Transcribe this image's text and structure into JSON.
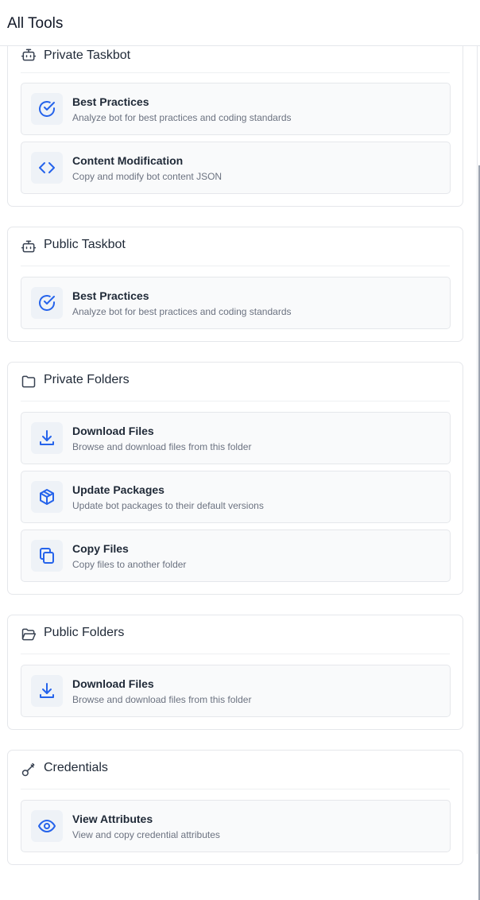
{
  "header": {
    "title": "All Tools"
  },
  "sections": [
    {
      "title": "Private Taskbot",
      "icon": "bot-icon",
      "tools": [
        {
          "title": "Best Practices",
          "description": "Analyze bot for best practices and coding standards",
          "icon": "check-circle-icon"
        },
        {
          "title": "Content Modification",
          "description": "Copy and modify bot content JSON",
          "icon": "code-icon"
        }
      ]
    },
    {
      "title": "Public Taskbot",
      "icon": "bot-icon",
      "tools": [
        {
          "title": "Best Practices",
          "description": "Analyze bot for best practices and coding standards",
          "icon": "check-circle-icon"
        }
      ]
    },
    {
      "title": "Private Folders",
      "icon": "folder-icon",
      "tools": [
        {
          "title": "Download Files",
          "description": "Browse and download files from this folder",
          "icon": "download-icon"
        },
        {
          "title": "Update Packages",
          "description": "Update bot packages to their default versions",
          "icon": "package-icon"
        },
        {
          "title": "Copy Files",
          "description": "Copy files to another folder",
          "icon": "copy-icon"
        }
      ]
    },
    {
      "title": "Public Folders",
      "icon": "folder-open-icon",
      "tools": [
        {
          "title": "Download Files",
          "description": "Browse and download files from this folder",
          "icon": "download-icon"
        }
      ]
    },
    {
      "title": "Credentials",
      "icon": "key-icon",
      "tools": [
        {
          "title": "View Attributes",
          "description": "View and copy credential attributes",
          "icon": "eye-icon"
        }
      ]
    }
  ],
  "colors": {
    "accent": "#2563eb",
    "icon_bg": "#eef2f7",
    "border": "#e5e7eb"
  }
}
